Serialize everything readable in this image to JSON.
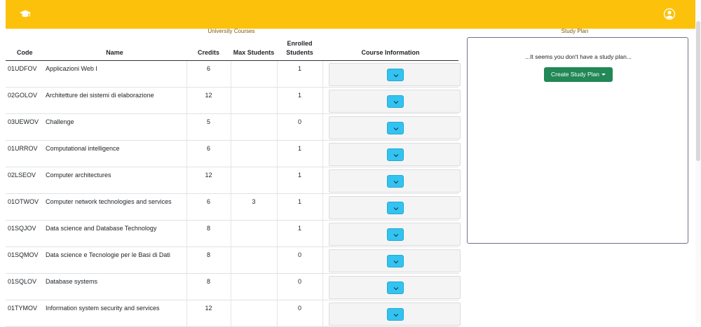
{
  "colors": {
    "navbar": "#fcc20b",
    "info_button": "#33c3f0",
    "create_button": "#218856"
  },
  "navbar": {
    "left_icon": "graduation-cap-icon",
    "right_icon": "user-circle-icon"
  },
  "courses_section": {
    "title": "University Courses",
    "headers": {
      "code": "Code",
      "name": "Name",
      "credits": "Credits",
      "max_students": "Max Students",
      "enrolled": "Enrolled Students",
      "info": "Course Information"
    },
    "rows": [
      {
        "code": "01UDFOV",
        "name": "Applicazioni Web I",
        "credits": "6",
        "max": "",
        "enrolled": "1"
      },
      {
        "code": "02GOLOV",
        "name": "Architetture dei sistemi di elaborazione",
        "credits": "12",
        "max": "",
        "enrolled": "1"
      },
      {
        "code": "03UEWOV",
        "name": "Challenge",
        "credits": "5",
        "max": "",
        "enrolled": "0"
      },
      {
        "code": "01URROV",
        "name": "Computational intelligence",
        "credits": "6",
        "max": "",
        "enrolled": "1"
      },
      {
        "code": "02LSEOV",
        "name": "Computer architectures",
        "credits": "12",
        "max": "",
        "enrolled": "1"
      },
      {
        "code": "01OTWOV",
        "name": "Computer network technologies and services",
        "credits": "6",
        "max": "3",
        "enrolled": "1"
      },
      {
        "code": "01SQJOV",
        "name": "Data science and Database Technology",
        "credits": "8",
        "max": "",
        "enrolled": "1"
      },
      {
        "code": "01SQMOV",
        "name": "Data science e Tecnologie per le Basi di Dati",
        "credits": "8",
        "max": "",
        "enrolled": "0"
      },
      {
        "code": "01SQLOV",
        "name": "Database systems",
        "credits": "8",
        "max": "",
        "enrolled": "0"
      },
      {
        "code": "01TYMOV",
        "name": "Information system security and services",
        "credits": "12",
        "max": "",
        "enrolled": "0"
      }
    ]
  },
  "study_plan": {
    "title": "Study Plan",
    "message": "...It seems you don't have a study plan...",
    "create_label": "Create Study Plan"
  }
}
